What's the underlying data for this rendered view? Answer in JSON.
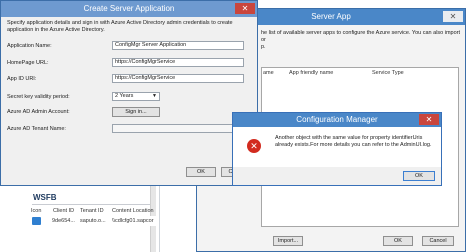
{
  "server_app": {
    "title": "Server App",
    "desc": "he list of available server apps to configure the Azure service. You can also import or",
    "desc2": "p.",
    "col_app_name": "App friendly name",
    "col_service_type": "Service Type",
    "col_prefix": "ame",
    "import_label": "Import...",
    "ok_label": "OK",
    "cancel_label": "Cancel"
  },
  "create_dialog": {
    "title": "Create Server Application",
    "desc": "Specify application details and sign in with Azure Active Directory admin credentials to create application in the Azure Active Directory.",
    "application_name_label": "Application Name:",
    "application_name_value": "ConfigMgr Server Application",
    "homepage_label": "HomePage URL:",
    "homepage_value": "https://ConfigMgrService",
    "app_id_label": "App ID URI:",
    "app_id_value": "https://ConfigMgrService",
    "validity_label": "Secret key validity period:",
    "validity_value": "2 Years",
    "admin_account_label": "Azure AD Admin Account:",
    "sign_in_label": "Sign in...",
    "tenant_label": "Azure AD Tenant Name:",
    "ok_label": "OK",
    "cancel_label": "Cancel"
  },
  "config_manager": {
    "title": "Configuration Manager",
    "message": "Another object with the same value for property identifierUris already exists.For more details you can refer to the AdminUI.log.",
    "ok_label": "OK"
  },
  "wsfb": {
    "title": "WSFB",
    "columns": [
      "Icon",
      "Client ID",
      "Tenant ID",
      "Content Location"
    ],
    "row": [
      "",
      "9de654...",
      "saputo.o...",
      "\\\\cdlcfg01.sapcor"
    ]
  }
}
